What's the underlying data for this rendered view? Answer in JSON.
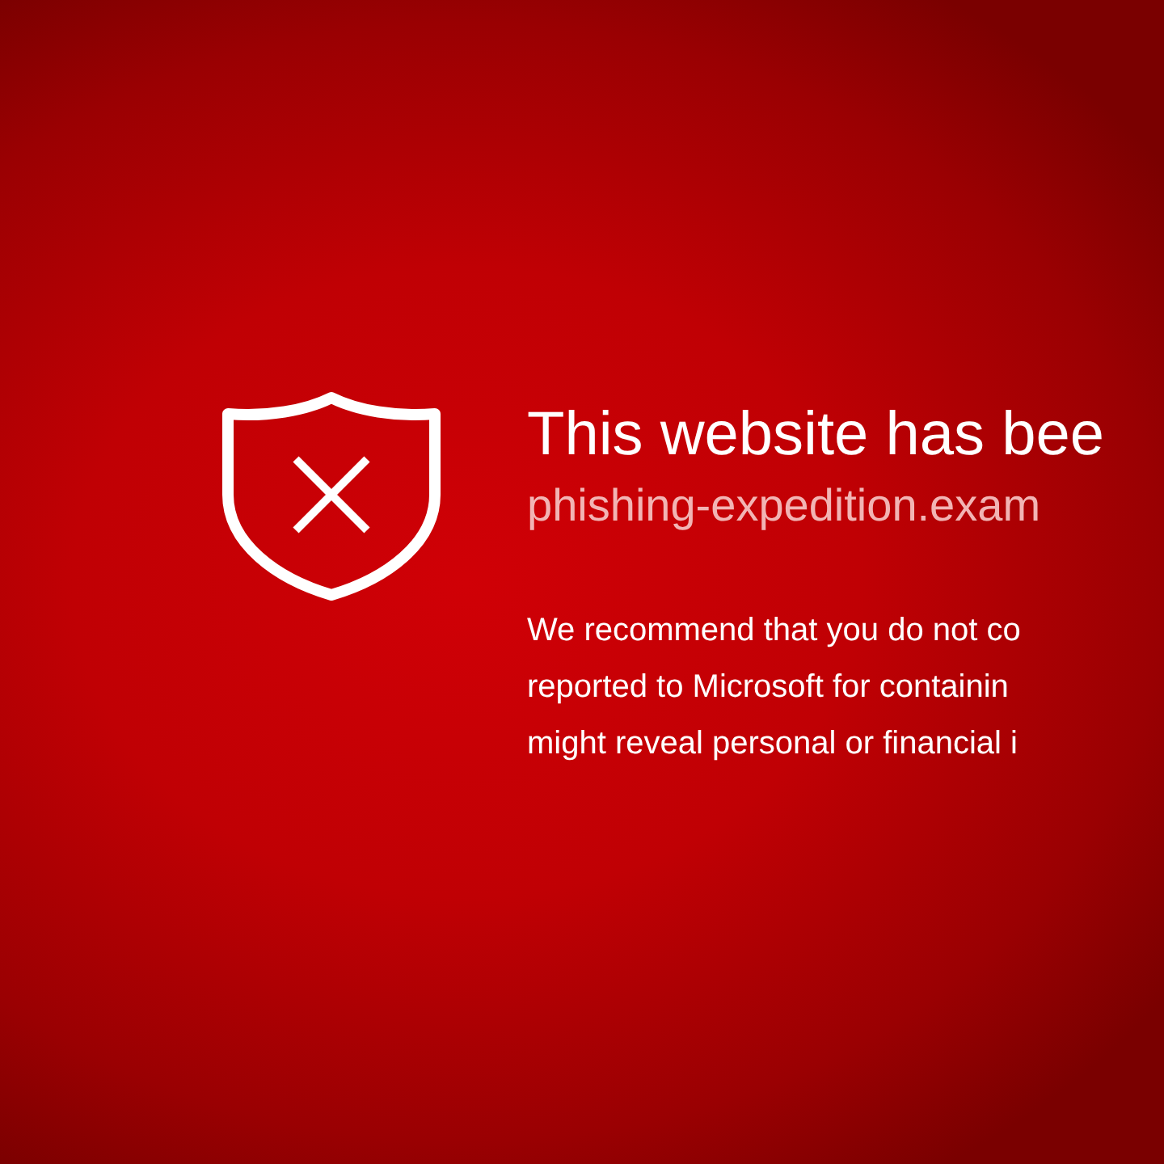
{
  "warning": {
    "title": "This website has bee",
    "url": "phishing-expedition.exam",
    "message_lines": [
      "We recommend that you do not co",
      "reported to Microsoft for containin",
      "might reveal personal or financial i"
    ]
  }
}
